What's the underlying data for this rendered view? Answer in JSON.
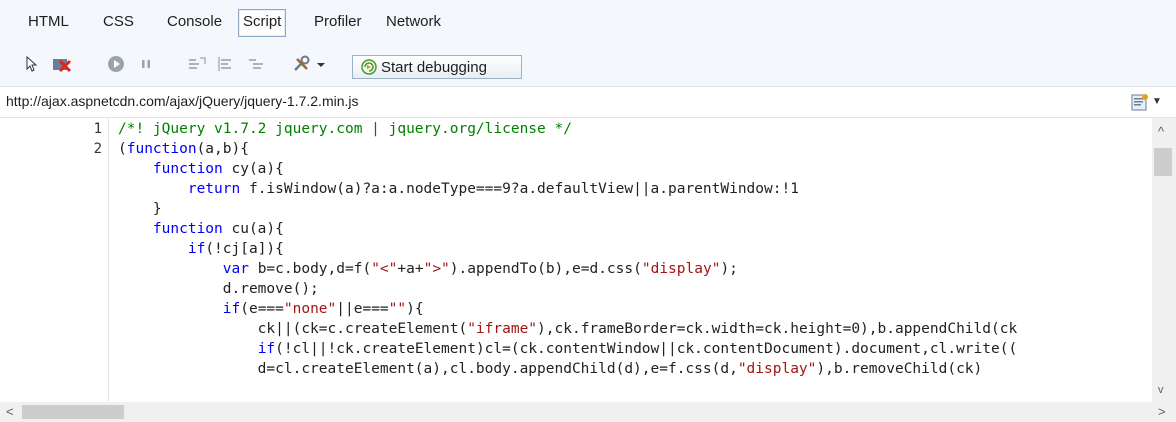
{
  "tabs": [
    {
      "label": "HTML",
      "active": false
    },
    {
      "label": "CSS",
      "active": false
    },
    {
      "label": "Console",
      "active": false
    },
    {
      "label": "Script",
      "active": true
    },
    {
      "label": "Profiler",
      "active": false
    },
    {
      "label": "Network",
      "active": false
    }
  ],
  "toolbar": {
    "start_debugging_label": "Start debugging",
    "icons": [
      "select-element-icon",
      "clear-breakpoints-icon",
      "continue-icon",
      "pause-icon",
      "step-into-icon",
      "step-over-icon",
      "step-out-icon",
      "tools-icon"
    ]
  },
  "url_bar": {
    "url": "http://ajax.aspnetcdn.com/ajax/jQuery/jquery-1.7.2.min.js"
  },
  "code": {
    "line_numbers": [
      "1",
      "2"
    ],
    "lines": [
      "/*! jQuery v1.7.2 jquery.com | jquery.org/license */",
      "(function(a,b){",
      "    function cy(a){",
      "        return f.isWindow(a)?a:a.nodeType===9?a.defaultView||a.parentWindow:!1",
      "    }",
      "    function cu(a){",
      "        if(!cj[a]){",
      "            var b=c.body,d=f(\"<\"+a+\">\").appendTo(b),e=d.css(\"display\");",
      "            d.remove();",
      "            if(e===\"none\"||e===\"\"){",
      "                ck||(ck=c.createElement(\"iframe\"),ck.frameBorder=ck.width=ck.height=0),b.appendChild(ck",
      "                if(!cl||!ck.createElement)cl=(ck.contentWindow||ck.contentDocument).document,cl.write((",
      "                d=cl.createElement(a),cl.body.appendChild(d),e=f.css(d,\"display\"),b.removeChild(ck)"
    ]
  },
  "colors": {
    "keyword": "#0000ff",
    "string": "#a31515",
    "comment": "#008000"
  }
}
